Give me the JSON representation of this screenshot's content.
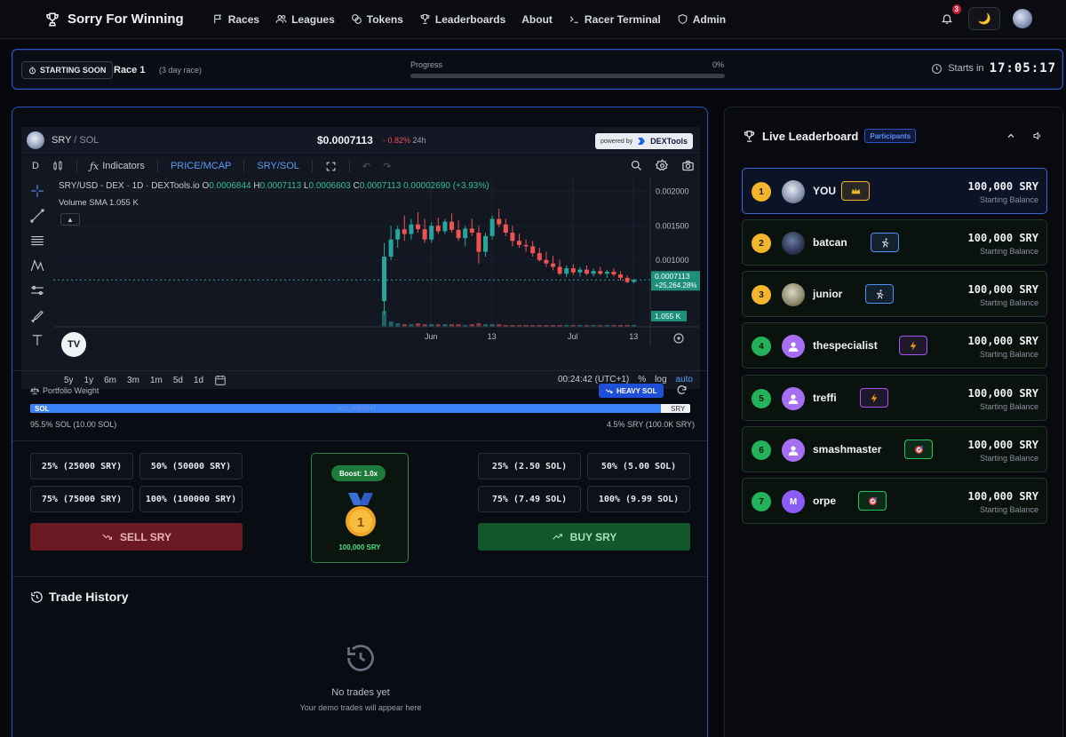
{
  "nav": {
    "brand": "Sorry For Winning",
    "links": [
      "Races",
      "Leagues",
      "Tokens",
      "Leaderboards",
      "About",
      "Racer Terminal",
      "Admin"
    ],
    "notifications": "3"
  },
  "race": {
    "status": "STARTING SOON",
    "name": "Race 1",
    "duration": "(3 day race)",
    "progress_label": "Progress",
    "progress_pct": "0%",
    "progress_fraction": 0,
    "starts_label": "Starts in",
    "countdown": "17:05:17"
  },
  "chart_header": {
    "base": "SRY",
    "quote": "SOL",
    "price": "$0.0007113",
    "change": "- 0.82%",
    "period": "24h",
    "powered_by": "powered by",
    "provider": "DEXTools"
  },
  "chart_toolbar": {
    "interval": "D",
    "indicators": "Indicators",
    "price_mcap": "PRICE/MCAP",
    "pair_toggle": "SRY/SOL"
  },
  "chart_legend": {
    "symbol": "SRY/USD - DEX · 1D · DEXTools.io",
    "o_label": "O",
    "o": "0.0006844",
    "h_label": "H",
    "h": "0.0007113",
    "l_label": "L",
    "l": "0.0006603",
    "c_label": "C",
    "c": "0.0007113",
    "change": "0.00002690 (+3.93%)",
    "volume_label": "Volume SMA",
    "volume": "1.055 K"
  },
  "chart_data": {
    "type": "candlestick",
    "y_ticks": [
      "0.002000",
      "0.001500",
      "0.001000"
    ],
    "x_ticks": [
      "Jun",
      "13",
      "Jul",
      "13"
    ],
    "last_price_label": "0.0007113",
    "last_change_label": "+25,264.28%",
    "volume_tag": "1.055 K",
    "ylim": [
      0,
      0.0021
    ],
    "candles": [
      [
        0.0004,
        0.00125,
        0.0002,
        0.00105
      ],
      [
        0.00105,
        0.0015,
        0.001,
        0.0013
      ],
      [
        0.0013,
        0.0015,
        0.00118,
        0.00145
      ],
      [
        0.00145,
        0.00165,
        0.00128,
        0.00138
      ],
      [
        0.00138,
        0.0016,
        0.0013,
        0.00152
      ],
      [
        0.00152,
        0.0017,
        0.0014,
        0.00145
      ],
      [
        0.00145,
        0.0016,
        0.00125,
        0.0013
      ],
      [
        0.0013,
        0.00155,
        0.00125,
        0.0015
      ],
      [
        0.0015,
        0.00162,
        0.00138,
        0.00142
      ],
      [
        0.00142,
        0.0016,
        0.00138,
        0.00156
      ],
      [
        0.00156,
        0.00168,
        0.0014,
        0.00144
      ],
      [
        0.00144,
        0.00158,
        0.00128,
        0.00132
      ],
      [
        0.00132,
        0.0015,
        0.0012,
        0.00146
      ],
      [
        0.00146,
        0.0016,
        0.00135,
        0.0014
      ],
      [
        0.0014,
        0.0015,
        0.00095,
        0.00112
      ],
      [
        0.00112,
        0.0014,
        0.00105,
        0.00135
      ],
      [
        0.00135,
        0.00165,
        0.0013,
        0.0016
      ],
      [
        0.0016,
        0.00175,
        0.00148,
        0.00152
      ],
      [
        0.00152,
        0.0016,
        0.00135,
        0.0014
      ],
      [
        0.0014,
        0.0015,
        0.0012,
        0.00128
      ],
      [
        0.00128,
        0.00138,
        0.00118,
        0.00122
      ],
      [
        0.00122,
        0.0013,
        0.00112,
        0.0012
      ],
      [
        0.0012,
        0.00128,
        0.00105,
        0.0011
      ],
      [
        0.0011,
        0.00118,
        0.00098,
        0.001
      ],
      [
        0.001,
        0.00112,
        0.0009,
        0.00095
      ],
      [
        0.00095,
        0.00106,
        0.00085,
        0.0009
      ],
      [
        0.0009,
        0.001,
        0.00078,
        0.0008
      ],
      [
        0.0008,
        0.00092,
        0.00075,
        0.00088
      ],
      [
        0.00088,
        0.00094,
        0.00078,
        0.00082
      ],
      [
        0.00082,
        0.0009,
        0.00076,
        0.00086
      ],
      [
        0.00086,
        0.00092,
        0.00078,
        0.0008
      ],
      [
        0.0008,
        0.00088,
        0.00076,
        0.00084
      ],
      [
        0.00084,
        0.0009,
        0.00078,
        0.0008
      ],
      [
        0.0008,
        0.00086,
        0.00074,
        0.00083
      ],
      [
        0.00083,
        0.00088,
        0.00076,
        0.00079
      ],
      [
        0.00079,
        0.00084,
        0.0007,
        0.00074
      ],
      [
        0.00074,
        0.00078,
        0.00066,
        0.00068
      ],
      [
        0.00068,
        0.00073,
        0.00066,
        0.00071
      ]
    ],
    "volumes": [
      18,
      6,
      4,
      3,
      3,
      4,
      3,
      3,
      3,
      3,
      3,
      3,
      2,
      3,
      4,
      3,
      3,
      3,
      2,
      2,
      2,
      2,
      2,
      2,
      2,
      2,
      2,
      2,
      2,
      2,
      2,
      2,
      2,
      2,
      2,
      2,
      2,
      2
    ],
    "up_color": "#26a69a",
    "down_color": "#ef5350"
  },
  "chart_footer": {
    "ranges": [
      "5y",
      "1y",
      "6m",
      "3m",
      "1m",
      "5d",
      "1d"
    ],
    "time": "00:24:42 (UTC+1)",
    "pct": "%",
    "log": "log",
    "auto": "auto"
  },
  "portfolio": {
    "label": "Portfolio Weight",
    "mode": "HEAVY SOL",
    "sol_label": "SOL",
    "sry_label": "SRY",
    "mid_label": "SOL WEIGHT",
    "sol_fraction": 0.955,
    "left_text": "95.5% SOL (10.00 SOL)",
    "right_text": "4.5% SRY (100.0K SRY)"
  },
  "trade": {
    "sell_amounts": [
      "25% (25000 SRY)",
      "50% (50000 SRY)",
      "75% (75000 SRY)",
      "100% (100000 SRY)"
    ],
    "buy_amounts": [
      "25% (2.50 SOL)",
      "50% (5.00 SOL)",
      "75% (7.49 SOL)",
      "100% (9.99 SOL)"
    ],
    "sell_label": "SELL SRY",
    "buy_label": "BUY SRY",
    "boost": "Boost: 1.0x",
    "medal_rank": "1",
    "boost_value": "100,000 SRY"
  },
  "history": {
    "title": "Trade History",
    "empty": "No trades yet",
    "empty_sub": "Your demo trades will appear here"
  },
  "leaderboard": {
    "title": "Live Leaderboard",
    "badge": "Participants",
    "rows": [
      {
        "rank": "1",
        "name": "YOU",
        "balance": "100,000 SRY",
        "sub": "Starting Balance",
        "tag": "crown-icon",
        "tag_color": "#f3b52b"
      },
      {
        "rank": "2",
        "name": "batcan",
        "balance": "100,000 SRY",
        "sub": "Starting Balance",
        "tag": "runner-icon",
        "tag_color": "#4f8ef7"
      },
      {
        "rank": "3",
        "name": "junior",
        "balance": "100,000 SRY",
        "sub": "Starting Balance",
        "tag": "runner-icon",
        "tag_color": "#4f8ef7"
      },
      {
        "rank": "4",
        "name": "thespecialist",
        "balance": "100,000 SRY",
        "sub": "Starting Balance",
        "tag": "bolt-icon",
        "tag_color": "#a855f7"
      },
      {
        "rank": "5",
        "name": "treffi",
        "balance": "100,000 SRY",
        "sub": "Starting Balance",
        "tag": "bolt-icon",
        "tag_color": "#a855f7"
      },
      {
        "rank": "6",
        "name": "smashmaster",
        "balance": "100,000 SRY",
        "sub": "Starting Balance",
        "tag": "target-icon",
        "tag_color": "#22c55e"
      },
      {
        "rank": "7",
        "name": "orpe",
        "balance": "100,000 SRY",
        "sub": "Starting Balance",
        "tag": "target-icon",
        "tag_color": "#22c55e",
        "initial": "M"
      }
    ]
  }
}
